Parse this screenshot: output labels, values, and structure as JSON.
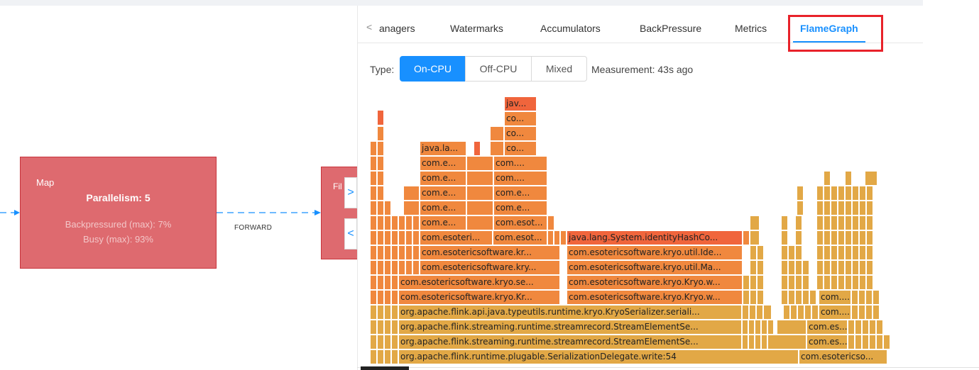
{
  "graph": {
    "map_node": {
      "title": "Map",
      "parallelism": "Parallelism: 5",
      "backpressured": "Backpressured (max): 7%",
      "busy": "Busy (max): 93%"
    },
    "next_node_title": "Fil",
    "edge_label": "FORWARD",
    "expand_glyph": ">",
    "collapse_glyph": "<"
  },
  "tabs": {
    "prev_glyph": "<",
    "items": [
      "anagers",
      "Watermarks",
      "Accumulators",
      "BackPressure",
      "Metrics",
      "FlameGraph"
    ],
    "active": "FlameGraph"
  },
  "flamegraph": {
    "type_label": "Type:",
    "types": [
      "On-CPU",
      "Off-CPU",
      "Mixed"
    ],
    "selected_type": "On-CPU",
    "measurement": "Measurement: 43s ago",
    "colors": {
      "yellow": "#e2a846",
      "orange": "#f0883e",
      "red": "#f0653c",
      "light_orange": "#ee9b47"
    },
    "frame_labels": {
      "l0": "org.apache.flink.runtime.plugable.SerializationDelegate.write:54",
      "l0b": "com.esotericso...",
      "l1": "org.apache.flink.streaming.runtime.streamrecord.StreamElementSe...",
      "l1b": "com.es...",
      "l2": "org.apache.flink.streaming.runtime.streamrecord.StreamElementSe...",
      "l2b": "com.es...",
      "l3": "org.apache.flink.api.java.typeutils.runtime.kryo.KryoSerializer.seriali...",
      "l3b": "com....",
      "l4a": "com.esotericsoftware.kryo.Kr...",
      "l4b": "com.esotericsoftware.kryo.Kryo.w...",
      "l4c": "com....",
      "l5a": "com.esotericsoftware.kryo.se...",
      "l5b": "com.esotericsoftware.kryo.Kryo.w...",
      "l6a": "com.esotericsoftware.kry...",
      "l6b": "com.esotericsoftware.kryo.util.Ma...",
      "l7a": "com.esotericsoftware.kr...",
      "l7b": "com.esotericsoftware.kryo.util.Ide...",
      "l8a": "com.esoteri...",
      "l8b": "com.esot...",
      "l8c": "java.lang.System.identityHashCo...",
      "l9a": "com.e...",
      "l9b": "com.esot...",
      "l10a": "com.e...",
      "l10b": "com.e...",
      "l11a": "com.e...",
      "l11b": "com.e...",
      "l12a": "com.e...",
      "l12b": "com....",
      "l13a": "com.e...",
      "l13b": "com....",
      "l14a": "java.la...",
      "l14b": "co...",
      "l15": "co...",
      "l16": "co...",
      "l17": "jav..."
    }
  }
}
